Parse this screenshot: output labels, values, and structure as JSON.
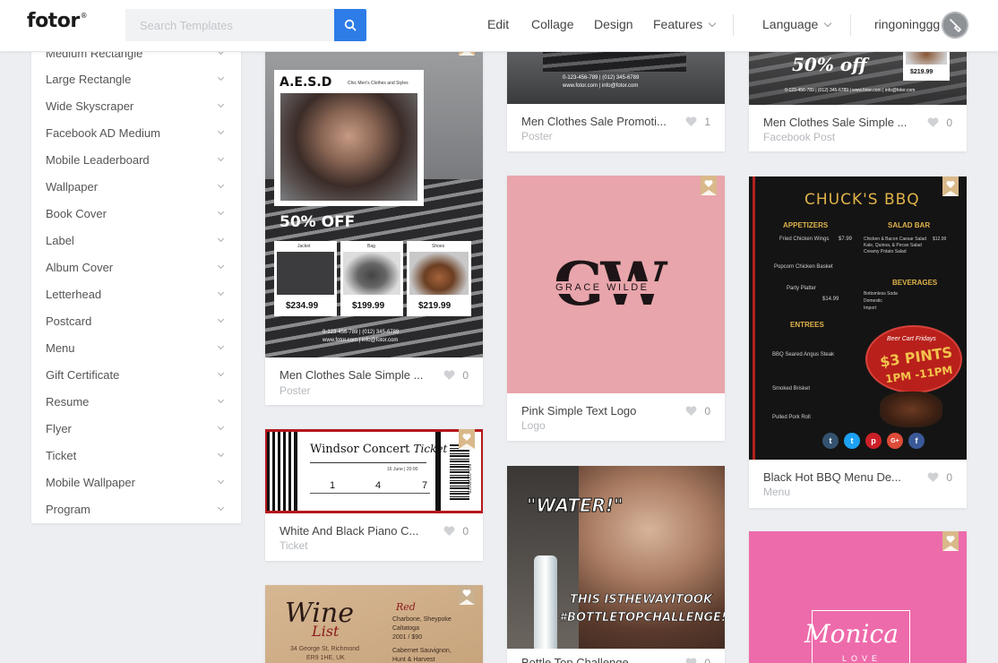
{
  "header": {
    "logo": "fotor",
    "logo_mark": "®",
    "search_placeholder": "Search Templates",
    "nav": {
      "edit": "Edit",
      "collage": "Collage",
      "design": "Design",
      "features": "Features",
      "language": "Language"
    },
    "username": "ringoninggg",
    "accent": "#2d7ce8"
  },
  "sidebar": {
    "items": [
      "Medium Rectangle",
      "Large Rectangle",
      "Wide Skyscraper",
      "Facebook AD Medium",
      "Mobile Leaderboard",
      "Wallpaper",
      "Book Cover",
      "Label",
      "Album Cover",
      "Letterhead",
      "Postcard",
      "Menu",
      "Gift Certificate",
      "Resume",
      "Flyer",
      "Ticket",
      "Mobile Wallpaper",
      "Program"
    ]
  },
  "cards": {
    "c1": {
      "title": "Men Clothes Sale Simple ...",
      "category": "Poster",
      "likes": "0",
      "thumb": {
        "brand": "A.E.S.D",
        "tagline": "Chic Men's Clothes and Styles",
        "offer": "50% OFF",
        "items": [
          {
            "label": "Jacket",
            "price": "$234.99"
          },
          {
            "label": "Bag",
            "price": "$199.99"
          },
          {
            "label": "Shoes",
            "price": "$219.99"
          }
        ],
        "contact": "0-123-456-789 | (012) 345-6789",
        "web": "www.fotor.com | info@fotor.com"
      }
    },
    "c2": {
      "title": "White And Black Piano C...",
      "category": "Ticket",
      "likes": "0",
      "thumb": {
        "heading": "Windsor Concert",
        "heading_script": "Ticket",
        "date": "16 June | 20:00",
        "n1": "1",
        "n2": "4",
        "n3": "7",
        "serial": "NO. 02345678"
      }
    },
    "c3": {
      "title": "",
      "category": "",
      "thumb": {
        "script": "Wine",
        "script2": "List",
        "addr1": "34 George St, Richmond",
        "addr2": "ER9 1HE, UK",
        "red": "Red",
        "w1": "Charbone, Sheypoke",
        "w2": "Caltatoga",
        "w3": "2001 / $90",
        "w4": "Cabernet Sauvignon,",
        "w5": "Hunt & Harvest"
      }
    },
    "c4": {
      "title": "Men Clothes Sale Promoti...",
      "category": "Poster",
      "likes": "1",
      "thumb": {
        "contact": "0-123-456-789 | (012) 345-6789",
        "web": "www.fotor.com | info@fotor.com"
      }
    },
    "c5": {
      "title": "Pink Simple Text Logo",
      "category": "Logo",
      "likes": "0",
      "thumb": {
        "monogram": "GW",
        "name": "GRACE WILDE"
      }
    },
    "c6": {
      "title": "Bottle Top Challenge",
      "likes": "0",
      "thumb": {
        "caption_top": "\"WATER!\"",
        "caption_bottom_1": "THIS ISTHEWAYITOOK",
        "caption_bottom_2": "#BOTTLETOPCHALLENGE!"
      }
    },
    "c7": {
      "title": "Men Clothes Sale Simple ...",
      "category": "Facebook Post",
      "likes": "0",
      "thumb": {
        "offer": "50% off",
        "price": "$219.99",
        "contact": "0-123-456-789 | (012) 345-6789 | www.fotor.com | info@fotor.com"
      }
    },
    "c8": {
      "title": "Black Hot BBQ Menu De...",
      "category": "Menu",
      "likes": "0",
      "thumb": {
        "heading": "CHUCK'S BBQ",
        "sec1": "APPETIZERS",
        "sec2": "SALAD BAR",
        "sec3": "BEVERAGES",
        "sec4": "ENTREES",
        "a1": "Fried Chicken Wings",
        "a2": "Popcorn Chicken Basket",
        "a3": "Party Platter",
        "s1": "Chicken & Bacon Caesar Salad",
        "s2": "Kale, Quinoa, & Pecan Salad",
        "s3": "Creamy Potato Salad",
        "b1": "Bottomless Soda",
        "b2": "Domestic",
        "b3": "Import",
        "e1": "BBQ Seared Angus Steak",
        "e2": "Smoked Brisket",
        "e3": "Pulled Pork Roll",
        "p1": "$7.99",
        "p2": "$12.99",
        "p3": "$14.99",
        "promo1": "Beer Cart Fridays",
        "promo2": "$3 PINTS",
        "promo3": "1PM -11PM",
        "social": [
          "t",
          "t",
          "p",
          "G+",
          "f"
        ]
      }
    },
    "c9": {
      "thumb": {
        "script": "Monica",
        "sub": "LOVE"
      }
    }
  }
}
